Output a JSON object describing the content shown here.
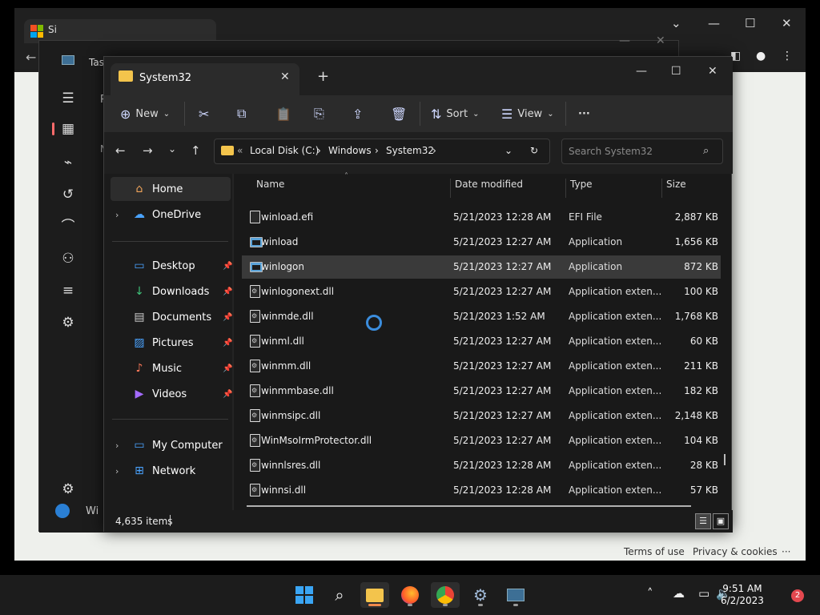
{
  "edge": {
    "tab_title": "Si",
    "footer_terms": "Terms of use",
    "footer_privacy": "Privacy & cookies",
    "footer_more": "···"
  },
  "task_manager": {
    "title": "Tas",
    "partial_label_1": "P",
    "partial_label_2": "N",
    "partial_label_3": "Wi"
  },
  "explorer": {
    "tab_title": "System32",
    "commands": {
      "new": "New",
      "sort": "Sort",
      "view": "View",
      "more": "···"
    },
    "breadcrumb": [
      "Local Disk (C:)",
      "Windows",
      "System32"
    ],
    "search_placeholder": "Search System32",
    "nav": {
      "home": "Home",
      "onedrive": "OneDrive",
      "desktop": "Desktop",
      "downloads": "Downloads",
      "documents": "Documents",
      "pictures": "Pictures",
      "music": "Music",
      "videos": "Videos",
      "my_computer": "My Computer",
      "network": "Network"
    },
    "columns": {
      "name": "Name",
      "date": "Date modified",
      "type": "Type",
      "size": "Size"
    },
    "files": [
      {
        "name": "winload.efi",
        "date": "5/21/2023 12:28 AM",
        "type": "EFI File",
        "size": "2,887 KB",
        "icon": "file"
      },
      {
        "name": "winload",
        "date": "5/21/2023 12:27 AM",
        "type": "Application",
        "size": "1,656 KB",
        "icon": "app"
      },
      {
        "name": "winlogon",
        "date": "5/21/2023 12:27 AM",
        "type": "Application",
        "size": "872 KB",
        "icon": "app"
      },
      {
        "name": "winlogonext.dll",
        "date": "5/21/2023 12:27 AM",
        "type": "Application exten...",
        "size": "100 KB",
        "icon": "dll"
      },
      {
        "name": "winmde.dll",
        "date": "5/21/2023 1:52 AM",
        "type": "Application exten...",
        "size": "1,768 KB",
        "icon": "dll"
      },
      {
        "name": "winml.dll",
        "date": "5/21/2023 12:27 AM",
        "type": "Application exten...",
        "size": "60 KB",
        "icon": "dll"
      },
      {
        "name": "winmm.dll",
        "date": "5/21/2023 12:27 AM",
        "type": "Application exten...",
        "size": "211 KB",
        "icon": "dll"
      },
      {
        "name": "winmmbase.dll",
        "date": "5/21/2023 12:27 AM",
        "type": "Application exten...",
        "size": "182 KB",
        "icon": "dll"
      },
      {
        "name": "winmsipc.dll",
        "date": "5/21/2023 12:27 AM",
        "type": "Application exten...",
        "size": "2,148 KB",
        "icon": "dll"
      },
      {
        "name": "WinMsoIrmProtector.dll",
        "date": "5/21/2023 12:27 AM",
        "type": "Application exten...",
        "size": "104 KB",
        "icon": "dll"
      },
      {
        "name": "winnlsres.dll",
        "date": "5/21/2023 12:28 AM",
        "type": "Application exten...",
        "size": "28 KB",
        "icon": "dll"
      },
      {
        "name": "winnsi.dll",
        "date": "5/21/2023 12:28 AM",
        "type": "Application exten...",
        "size": "57 KB",
        "icon": "dll"
      }
    ],
    "selected_file": "winlogon",
    "status_count": "4,635 items"
  },
  "taskbar": {
    "time": "9:51 AM",
    "date": "6/2/2023",
    "notification_count": "2"
  },
  "colors": {
    "accent": "#3aa5f4",
    "folder": "#f3c44c",
    "badge": "#e4484f"
  }
}
